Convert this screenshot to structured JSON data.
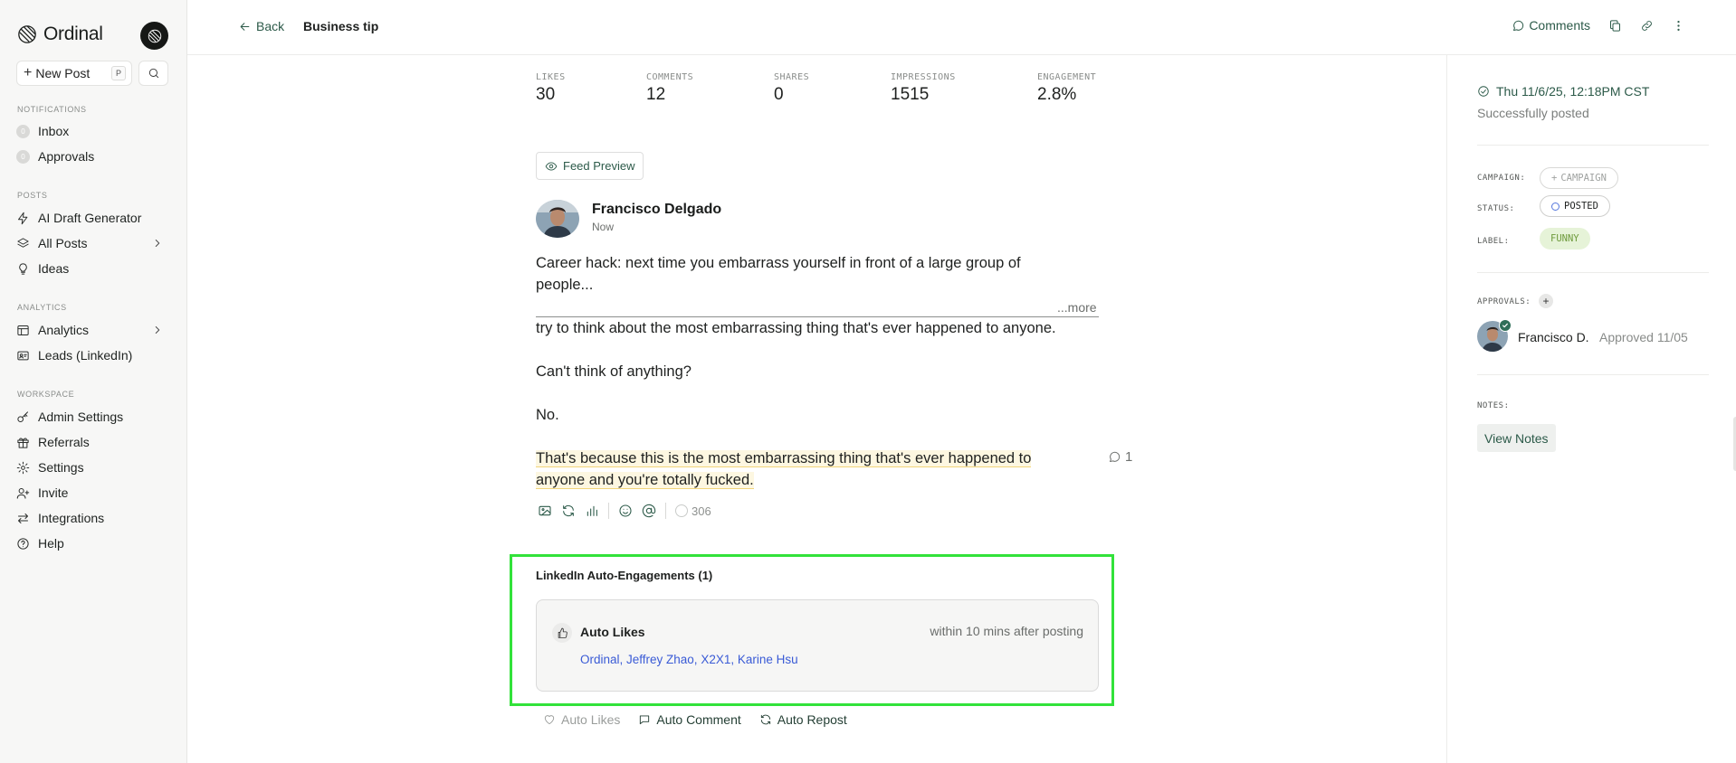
{
  "sidebar": {
    "brand": "Ordinal",
    "new_post_label": "New Post",
    "new_post_shortcut": "P",
    "sections": {
      "notifications": "NOTIFICATIONS",
      "posts": "POSTS",
      "analytics": "ANALYTICS",
      "workspace": "WORKSPACE"
    },
    "items": {
      "inbox": {
        "label": "Inbox",
        "badge": "0"
      },
      "approvals": {
        "label": "Approvals",
        "badge": "0"
      },
      "ai_draft": "AI Draft Generator",
      "all_posts": "All Posts",
      "ideas": "Ideas",
      "analytics": "Analytics",
      "leads": "Leads (LinkedIn)",
      "admin_settings": "Admin Settings",
      "referrals": "Referrals",
      "settings": "Settings",
      "invite": "Invite",
      "integrations": "Integrations",
      "help": "Help"
    }
  },
  "header": {
    "back_label": "Back",
    "title": "Business tip",
    "comments_label": "Comments"
  },
  "metrics": [
    {
      "label": "LIKES",
      "value": "30"
    },
    {
      "label": "COMMENTS",
      "value": "12"
    },
    {
      "label": "SHARES",
      "value": "0"
    },
    {
      "label": "IMPRESSIONS",
      "value": "1515"
    },
    {
      "label": "ENGAGEMENT",
      "value": "2.8%"
    }
  ],
  "post": {
    "feed_preview_label": "Feed Preview",
    "author": "Francisco Delgado",
    "time": "Now",
    "para1": "Career hack: next time you embarrass yourself in front of a large group of people...",
    "more_label": "...more",
    "para2": "try to think about the most embarrassing thing that's ever happened to anyone.",
    "para3": "Can't think of anything?",
    "para4": "No.",
    "para5_line1": "That's because this is the most embarrassing thing that's ever happened to",
    "para5_line2": "anyone and you're totally fucked.",
    "comment_count": "1",
    "char_count": "306"
  },
  "auto_engagements": {
    "title": "LinkedIn Auto-Engagements (1)",
    "card_title": "Auto Likes",
    "card_timing": "within 10 mins after posting",
    "card_people": "Ordinal, Jeffrey Zhao, X2X1, Karine Hsu",
    "actions": {
      "auto_likes": "Auto Likes",
      "auto_comment": "Auto Comment",
      "auto_repost": "Auto Repost"
    }
  },
  "right_panel": {
    "posted_date": "Thu 11/6/25, 12:18PM CST",
    "posted_status": "Successfully posted",
    "campaign_label": "CAMPAIGN:",
    "campaign_chip": "CAMPAIGN",
    "status_label": "STATUS:",
    "status_chip": "POSTED",
    "label_label": "LABEL:",
    "label_chip": "FUNNY",
    "approvals_label": "APPROVALS:",
    "approver_name": "Francisco D.",
    "approver_date": "Approved 11/05",
    "notes_label": "NOTES:",
    "view_notes_label": "View Notes"
  },
  "colors": {
    "accent": "#2c5a49",
    "link_blue": "#3a5bd6",
    "highlight_box": "#32e23a",
    "label_chip_bg": "#e6f3d8"
  }
}
